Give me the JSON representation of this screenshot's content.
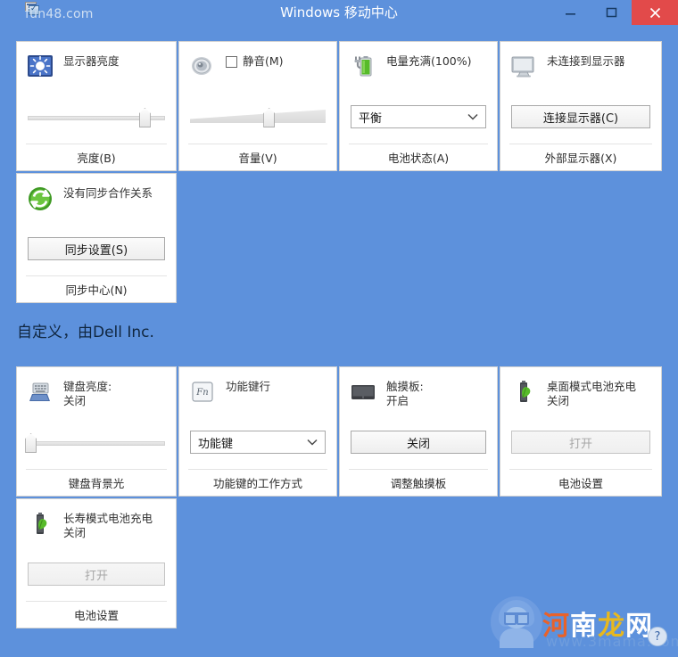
{
  "window": {
    "title": "Windows 移动中心",
    "icon": "mobility-center-icon",
    "minimize_glyph": "–",
    "maximize_glyph": "□",
    "close_glyph": "✕"
  },
  "watermarks": {
    "top_left": "fun48.com",
    "bottom_brand_1": "河",
    "bottom_brand_2": "南",
    "bottom_brand_3": "龙",
    "bottom_brand_4": "网",
    "bottom_url": "www.3mama.com",
    "badge_glyph": "?"
  },
  "sections": [
    {
      "name": "windows-default",
      "heading": "",
      "rows": [
        {
          "tiles": [
            {
              "name": "display-brightness",
              "icon": "brightness-icon",
              "label": "显示器亮度",
              "label2": "",
              "control": "slider",
              "slider_style": "flat",
              "slider_value": 85,
              "footer": "亮度(B)"
            },
            {
              "name": "volume",
              "icon": "speaker-icon",
              "label": "静音(M)",
              "label2": "",
              "control": "checkbox-slider",
              "checkbox_checked": false,
              "slider_style": "wedge",
              "slider_value": 58,
              "footer": "音量(V)"
            },
            {
              "name": "battery-status",
              "icon": "battery-plugged-icon",
              "label": "电量充满(100%)",
              "label2": "",
              "control": "select",
              "select_value": "平衡",
              "footer": "电池状态(A)"
            },
            {
              "name": "external-display",
              "icon": "monitor-icon",
              "label": "未连接到显示器",
              "label2": "",
              "control": "button",
              "button_label": "连接显示器(C)",
              "button_disabled": false,
              "footer": "外部显示器(X)"
            }
          ]
        },
        {
          "tiles": [
            {
              "name": "sync-center",
              "icon": "sync-icon",
              "label": "没有同步合作关系",
              "label2": "",
              "control": "button",
              "button_label": "同步设置(S)",
              "button_disabled": false,
              "footer": "同步中心(N)"
            }
          ]
        }
      ]
    },
    {
      "name": "dell-custom",
      "heading": "自定义，由Dell Inc.",
      "rows": [
        {
          "tiles": [
            {
              "name": "keyboard-brightness",
              "icon": "keyboard-icon",
              "label": "键盘亮度:",
              "label2": "关闭",
              "control": "slider",
              "slider_style": "flat",
              "slider_value": 2,
              "footer": "键盘背景光"
            },
            {
              "name": "function-key-row",
              "icon": "fn-key-icon",
              "label": "功能键行",
              "label2": "",
              "control": "select",
              "select_value": "功能键",
              "footer": "功能键的工作方式"
            },
            {
              "name": "touchpad",
              "icon": "touchpad-icon",
              "label": "触摸板:",
              "label2": "开启",
              "control": "button",
              "button_label": "关闭",
              "button_disabled": false,
              "footer": "调整触摸板"
            },
            {
              "name": "desktop-mode-battery",
              "icon": "battery-leaf-icon",
              "label": "桌面模式电池充电",
              "label2": "关闭",
              "control": "button",
              "button_label": "打开",
              "button_disabled": true,
              "footer": "电池设置"
            }
          ]
        },
        {
          "tiles": [
            {
              "name": "longevity-mode-battery",
              "icon": "battery-leaf-icon",
              "label": "长寿模式电池充电",
              "label2": "关闭",
              "control": "button",
              "button_label": "打开",
              "button_disabled": true,
              "footer": "电池设置"
            }
          ]
        }
      ]
    }
  ],
  "colors": {
    "background": "#5d91dc",
    "close_button": "#e24a4a",
    "tile_background": "#ffffff",
    "heading_text": "#10263f"
  }
}
